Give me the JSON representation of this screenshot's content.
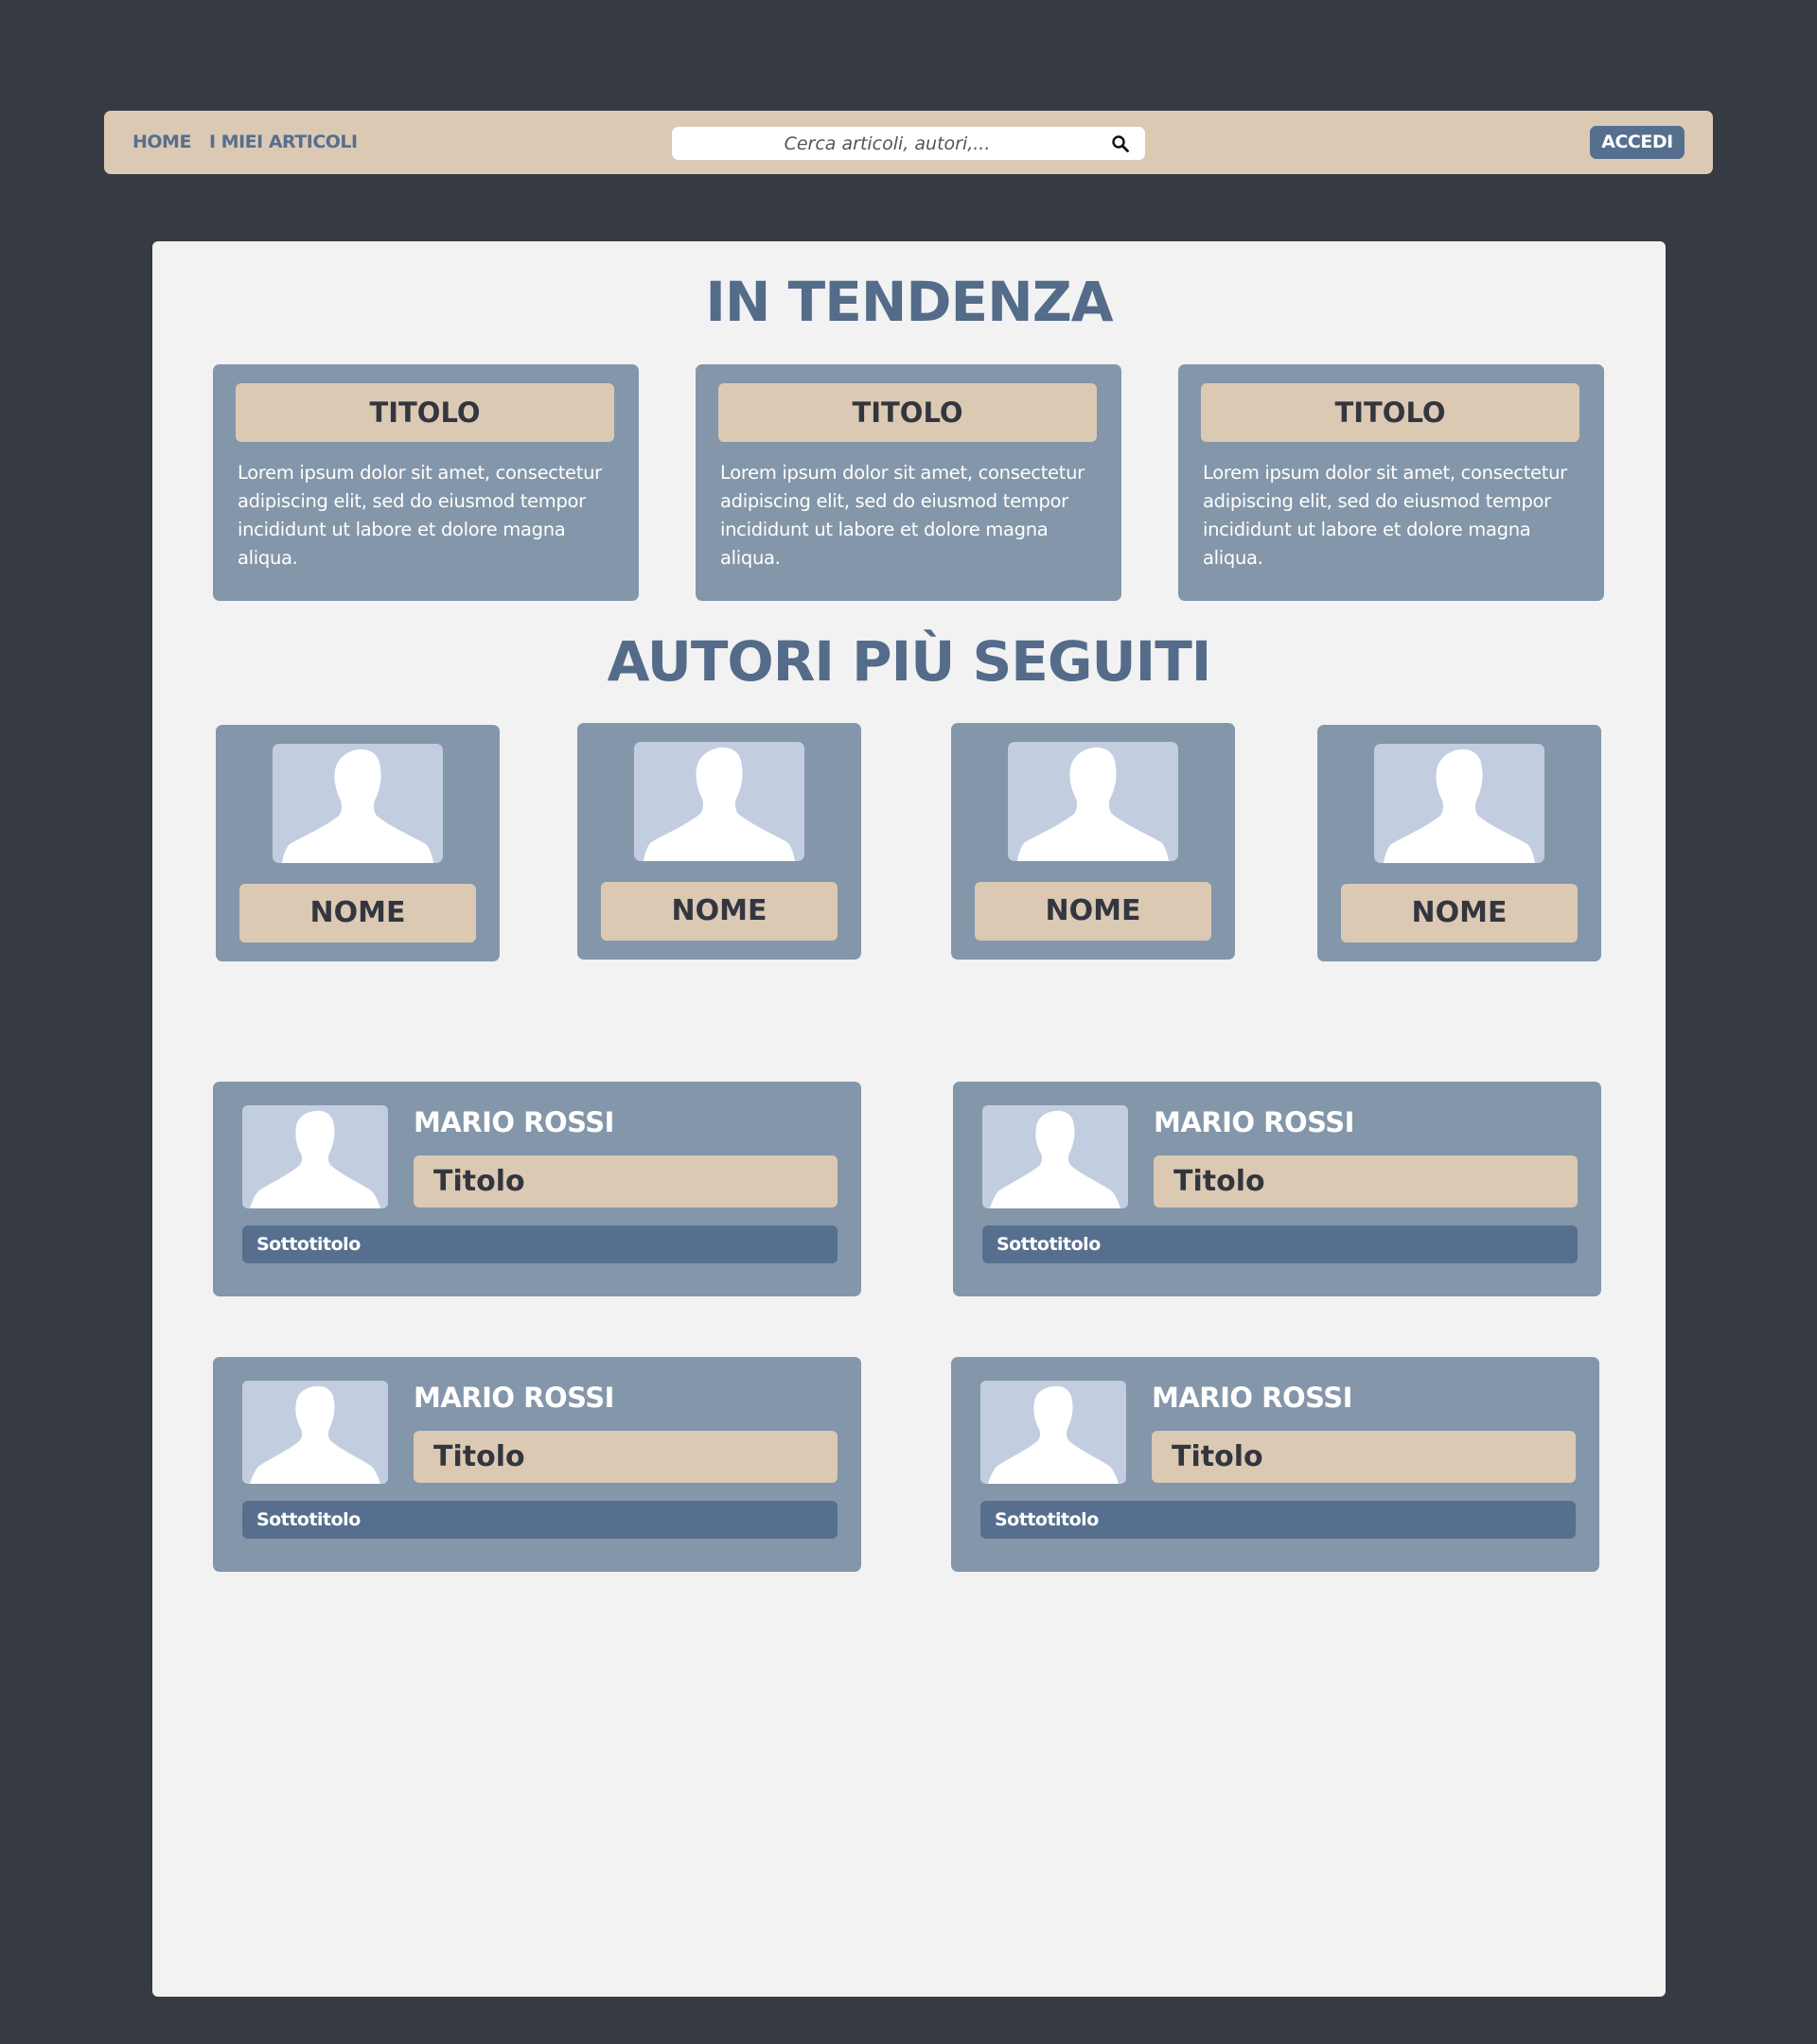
{
  "nav": {
    "home": "HOME",
    "my_articles": "I MIEI ARTICOLI",
    "search_placeholder": "Cerca articoli, autori,...",
    "login": "ACCEDI"
  },
  "trending": {
    "heading": "IN TENDENZA",
    "cards": [
      {
        "title": "TITOLO",
        "text": "Lorem ipsum dolor sit amet, consectetur adipiscing elit, sed do eiusmod tempor incididunt ut labore et dolore magna aliqua."
      },
      {
        "title": "TITOLO",
        "text": "Lorem ipsum dolor sit amet, consectetur adipiscing elit, sed do eiusmod tempor incididunt ut labore et dolore magna aliqua."
      },
      {
        "title": "TITOLO",
        "text": "Lorem ipsum dolor sit amet, consectetur adipiscing elit, sed do eiusmod tempor incididunt ut labore et dolore magna aliqua."
      }
    ]
  },
  "authors": {
    "heading": "AUTORI PIÙ SEGUITI",
    "cards": [
      {
        "name": "NOME"
      },
      {
        "name": "NOME"
      },
      {
        "name": "NOME"
      },
      {
        "name": "NOME"
      }
    ]
  },
  "articles": [
    {
      "author": "MARIO ROSSI",
      "title": "Titolo",
      "subtitle": "Sottotitolo"
    },
    {
      "author": "MARIO ROSSI",
      "title": "Titolo",
      "subtitle": "Sottotitolo"
    },
    {
      "author": "MARIO ROSSI",
      "title": "Titolo",
      "subtitle": "Sottotitolo"
    },
    {
      "author": "MARIO ROSSI",
      "title": "Titolo",
      "subtitle": "Sottotitolo"
    }
  ],
  "icons": {
    "search": "search-icon",
    "avatar": "user-silhouette-icon"
  },
  "colors": {
    "background": "#363a43",
    "navbar": "#dbc9b4",
    "accent": "#566f8e",
    "card": "#8496a9",
    "panel": "#f2f2f2",
    "avatar_bg": "#c3cde0"
  }
}
